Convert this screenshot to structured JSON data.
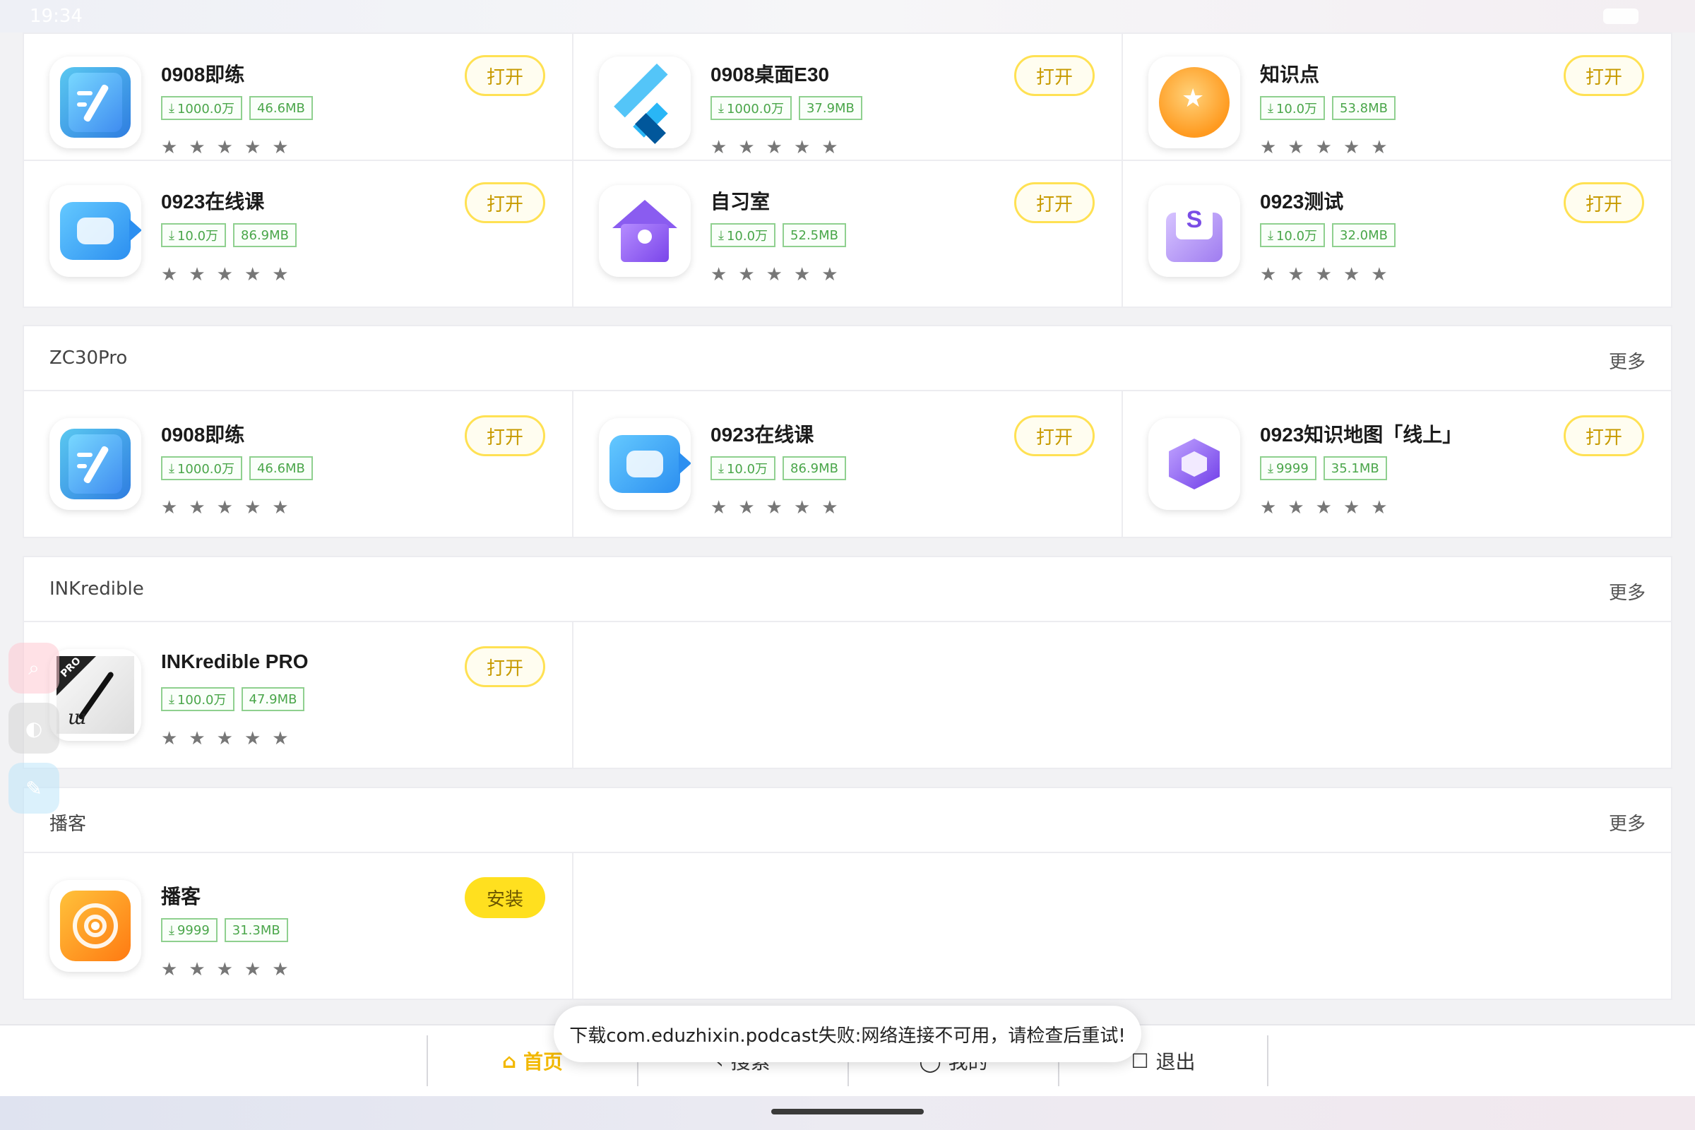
{
  "status_bar": {
    "time": "19:34"
  },
  "rows": [
    {
      "apps": [
        {
          "name": "0908即练",
          "downloads": "1000.0万",
          "size": "46.6MB",
          "action": "打开",
          "icon": "notebook-pen-icon"
        },
        {
          "name": "0908桌面E30",
          "downloads": "1000.0万",
          "size": "37.9MB",
          "action": "打开",
          "icon": "flutter-icon"
        },
        {
          "name": "知识点",
          "downloads": "10.0万",
          "size": "53.8MB",
          "action": "打开",
          "icon": "lightbulb-star-icon"
        }
      ]
    },
    {
      "apps": [
        {
          "name": "0923在线课",
          "downloads": "10.0万",
          "size": "86.9MB",
          "action": "打开",
          "icon": "video-class-icon"
        },
        {
          "name": "自习室",
          "downloads": "10.0万",
          "size": "52.5MB",
          "action": "打开",
          "icon": "study-house-icon"
        },
        {
          "name": "0923测试",
          "downloads": "10.0万",
          "size": "32.0MB",
          "action": "打开",
          "icon": "test-paper-icon"
        }
      ]
    }
  ],
  "sections": [
    {
      "title": "ZC30Pro",
      "more": "更多",
      "apps": [
        {
          "name": "0908即练",
          "downloads": "1000.0万",
          "size": "46.6MB",
          "action": "打开",
          "icon": "notebook-pen-icon"
        },
        {
          "name": "0923在线课",
          "downloads": "10.0万",
          "size": "86.9MB",
          "action": "打开",
          "icon": "video-class-icon"
        },
        {
          "name": "0923知识地图「线上」",
          "downloads": "9999",
          "size": "35.1MB",
          "action": "打开",
          "icon": "hexagon-map-icon"
        }
      ]
    },
    {
      "title": "INKredible",
      "more": "更多",
      "apps": [
        {
          "name": "INKredible PRO",
          "downloads": "100.0万",
          "size": "47.9MB",
          "action": "打开",
          "icon": "inkredible-pen-icon"
        }
      ]
    },
    {
      "title": "播客",
      "more": "更多",
      "apps": [
        {
          "name": "播客",
          "downloads": "9999",
          "size": "31.3MB",
          "action": "安装",
          "icon": "podcast-icon"
        }
      ]
    }
  ],
  "stars": "★",
  "ink_pro_label": "PRO",
  "test_icon_letter": "S",
  "bottom_nav": [
    {
      "label": "首页",
      "icon": "⌂",
      "active": true
    },
    {
      "label": "搜索",
      "icon": "‹",
      "active": false
    },
    {
      "label": "我的",
      "icon": "◯",
      "active": false
    },
    {
      "label": "退出",
      "icon": "☐",
      "active": false
    }
  ],
  "toast": "下载com.eduzhixin.podcast失败:网络连接不可用，请检查后重试!",
  "colors": {
    "accent": "#ffe153",
    "install": "#ffe01f",
    "tag_green": "#4aa64a",
    "nav_active": "#f2b800"
  }
}
